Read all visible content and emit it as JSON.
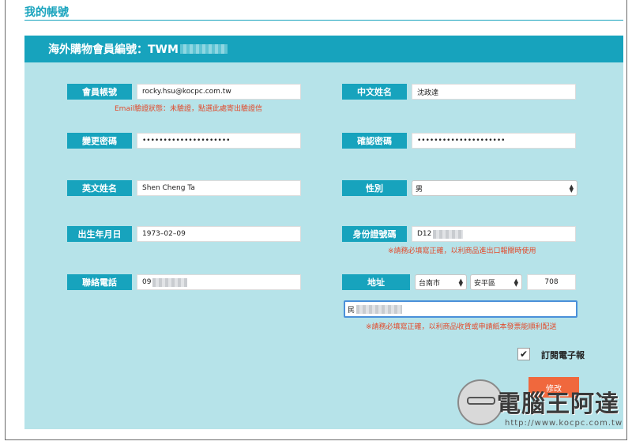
{
  "page": {
    "title": "我的帳號"
  },
  "panel": {
    "header_prefix": "海外購物會員編號：TWM"
  },
  "fields": {
    "account": {
      "label": "會員帳號",
      "value": "rocky.hsu@kocpc.com.tw"
    },
    "email_note": "Email驗證狀態：未驗證，點選此處寄出驗證信",
    "chinese_name": {
      "label": "中文姓名",
      "value": "沈政達"
    },
    "change_password": {
      "label": "變更密碼",
      "value": "•••••••••••••••••••••"
    },
    "confirm_password": {
      "label": "確認密碼",
      "value": "•••••••••••••••••••••"
    },
    "english_name": {
      "label": "英文姓名",
      "value": "Shen Cheng Ta"
    },
    "gender": {
      "label": "性別",
      "value": "男"
    },
    "birthday": {
      "label": "出生年月日",
      "value": "1973–02–09"
    },
    "id_number": {
      "label": "身份證號碼",
      "value": "D12"
    },
    "id_note": "※請務必填寫正確，以利商品進出口報關時使用",
    "phone": {
      "label": "聯絡電話",
      "value": "09"
    },
    "address": {
      "label": "地址",
      "city": "台南市",
      "district": "安平區",
      "zip": "708",
      "street": "民"
    },
    "address_note": "※請務必填寫正確，以利商品收貨或申請紙本發票能順利配送"
  },
  "newsletter": {
    "label": "訂閱電子報",
    "checked": "✔"
  },
  "submit": {
    "label": "修改"
  },
  "watermark": {
    "text": "電腦王阿達",
    "url": "http://www.kocpc.com.tw"
  }
}
